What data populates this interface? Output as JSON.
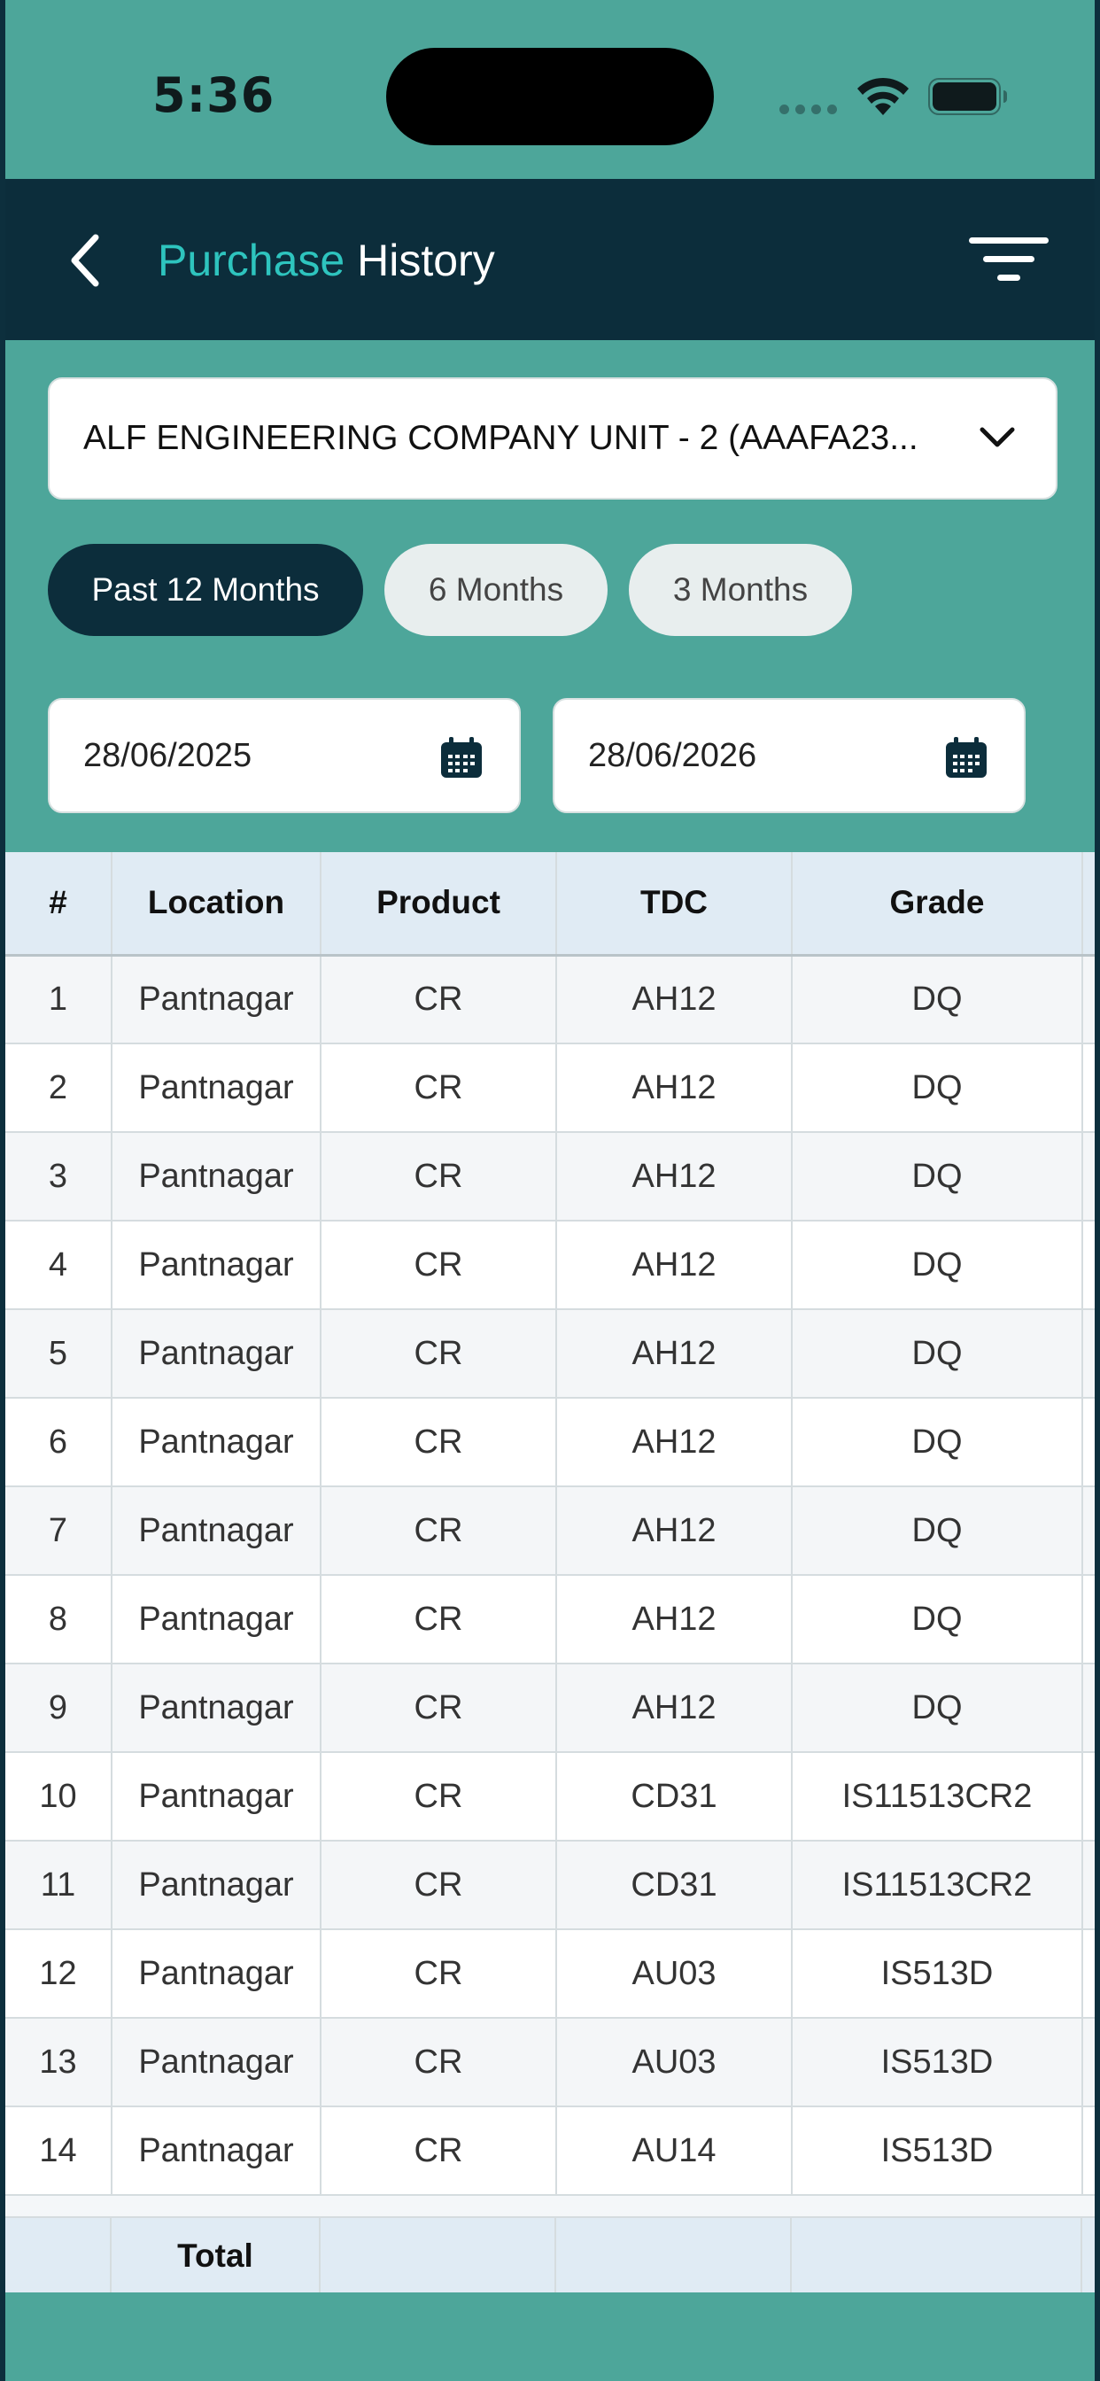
{
  "status_bar": {
    "time": "5:36"
  },
  "header": {
    "title_accent": "Purchase",
    "title_main": "History"
  },
  "company_select": {
    "selected": "ALF ENGINEERING COMPANY UNIT - 2 (AAAFA23..."
  },
  "period_tabs": [
    {
      "label": "Past 12 Months",
      "active": true
    },
    {
      "label": "6 Months",
      "active": false
    },
    {
      "label": "3 Months",
      "active": false
    }
  ],
  "date_range": {
    "from": "28/06/2025",
    "to": "28/06/2026"
  },
  "table": {
    "columns": [
      "#",
      "Location",
      "Product",
      "TDC",
      "Grade"
    ],
    "rows": [
      [
        "1",
        "Pantnagar",
        "CR",
        "AH12",
        "DQ"
      ],
      [
        "2",
        "Pantnagar",
        "CR",
        "AH12",
        "DQ"
      ],
      [
        "3",
        "Pantnagar",
        "CR",
        "AH12",
        "DQ"
      ],
      [
        "4",
        "Pantnagar",
        "CR",
        "AH12",
        "DQ"
      ],
      [
        "5",
        "Pantnagar",
        "CR",
        "AH12",
        "DQ"
      ],
      [
        "6",
        "Pantnagar",
        "CR",
        "AH12",
        "DQ"
      ],
      [
        "7",
        "Pantnagar",
        "CR",
        "AH12",
        "DQ"
      ],
      [
        "8",
        "Pantnagar",
        "CR",
        "AH12",
        "DQ"
      ],
      [
        "9",
        "Pantnagar",
        "CR",
        "AH12",
        "DQ"
      ],
      [
        "10",
        "Pantnagar",
        "CR",
        "CD31",
        "IS11513CR2"
      ],
      [
        "11",
        "Pantnagar",
        "CR",
        "CD31",
        "IS11513CR2"
      ],
      [
        "12",
        "Pantnagar",
        "CR",
        "AU03",
        "IS513D"
      ],
      [
        "13",
        "Pantnagar",
        "CR",
        "AU03",
        "IS513D"
      ],
      [
        "14",
        "Pantnagar",
        "CR",
        "AU14",
        "IS513D"
      ]
    ],
    "total_label": "Total"
  },
  "colors": {
    "header_bg": "#0c2d3b",
    "accent": "#2ec4be",
    "page_bg": "#4da69a"
  },
  "icons": {
    "back": "chevron-left-icon",
    "filter": "filter-icon",
    "dropdown": "chevron-down-icon",
    "calendar": "calendar-icon"
  }
}
